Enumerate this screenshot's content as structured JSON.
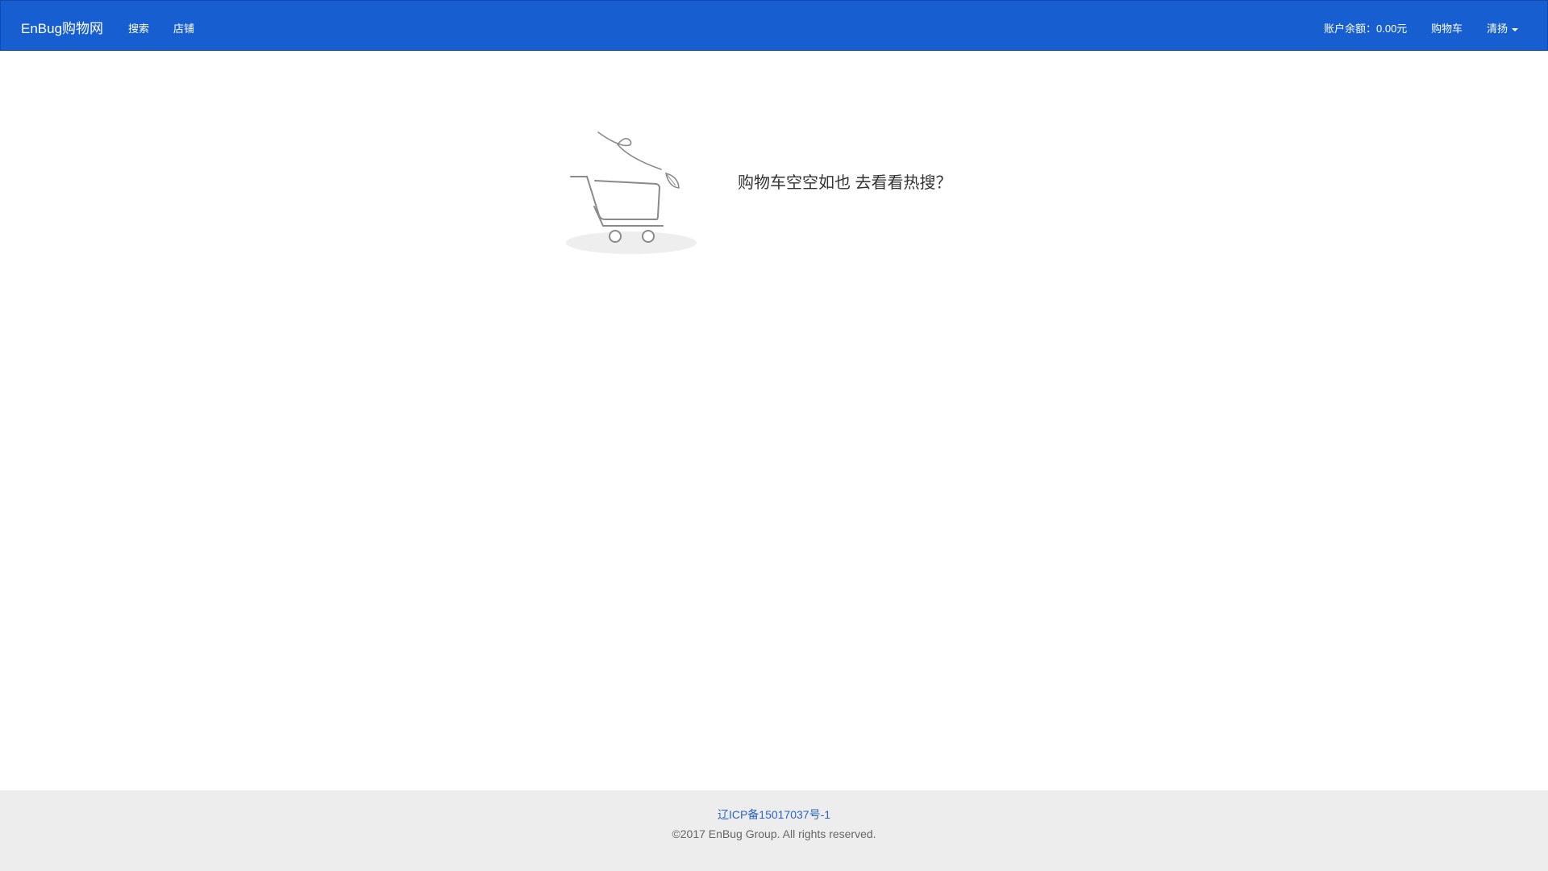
{
  "navbar": {
    "brand": "EnBug购物网",
    "links": {
      "search": "搜索",
      "shops": "店铺"
    },
    "balance": "账户余额：0.00元",
    "cart": "购物车",
    "user": "清扬"
  },
  "main": {
    "empty_message": "购物车空空如也 去看看热搜？"
  },
  "footer": {
    "icp": "辽ICP备15017037号-1",
    "copyright": "©2017 EnBug Group. All rights reserved."
  },
  "colors": {
    "navbar": "#175fd1",
    "link": "#2a63c9",
    "footer_bg": "#ededed"
  },
  "icons": {
    "cart_illustration": "empty-cart-icon"
  }
}
